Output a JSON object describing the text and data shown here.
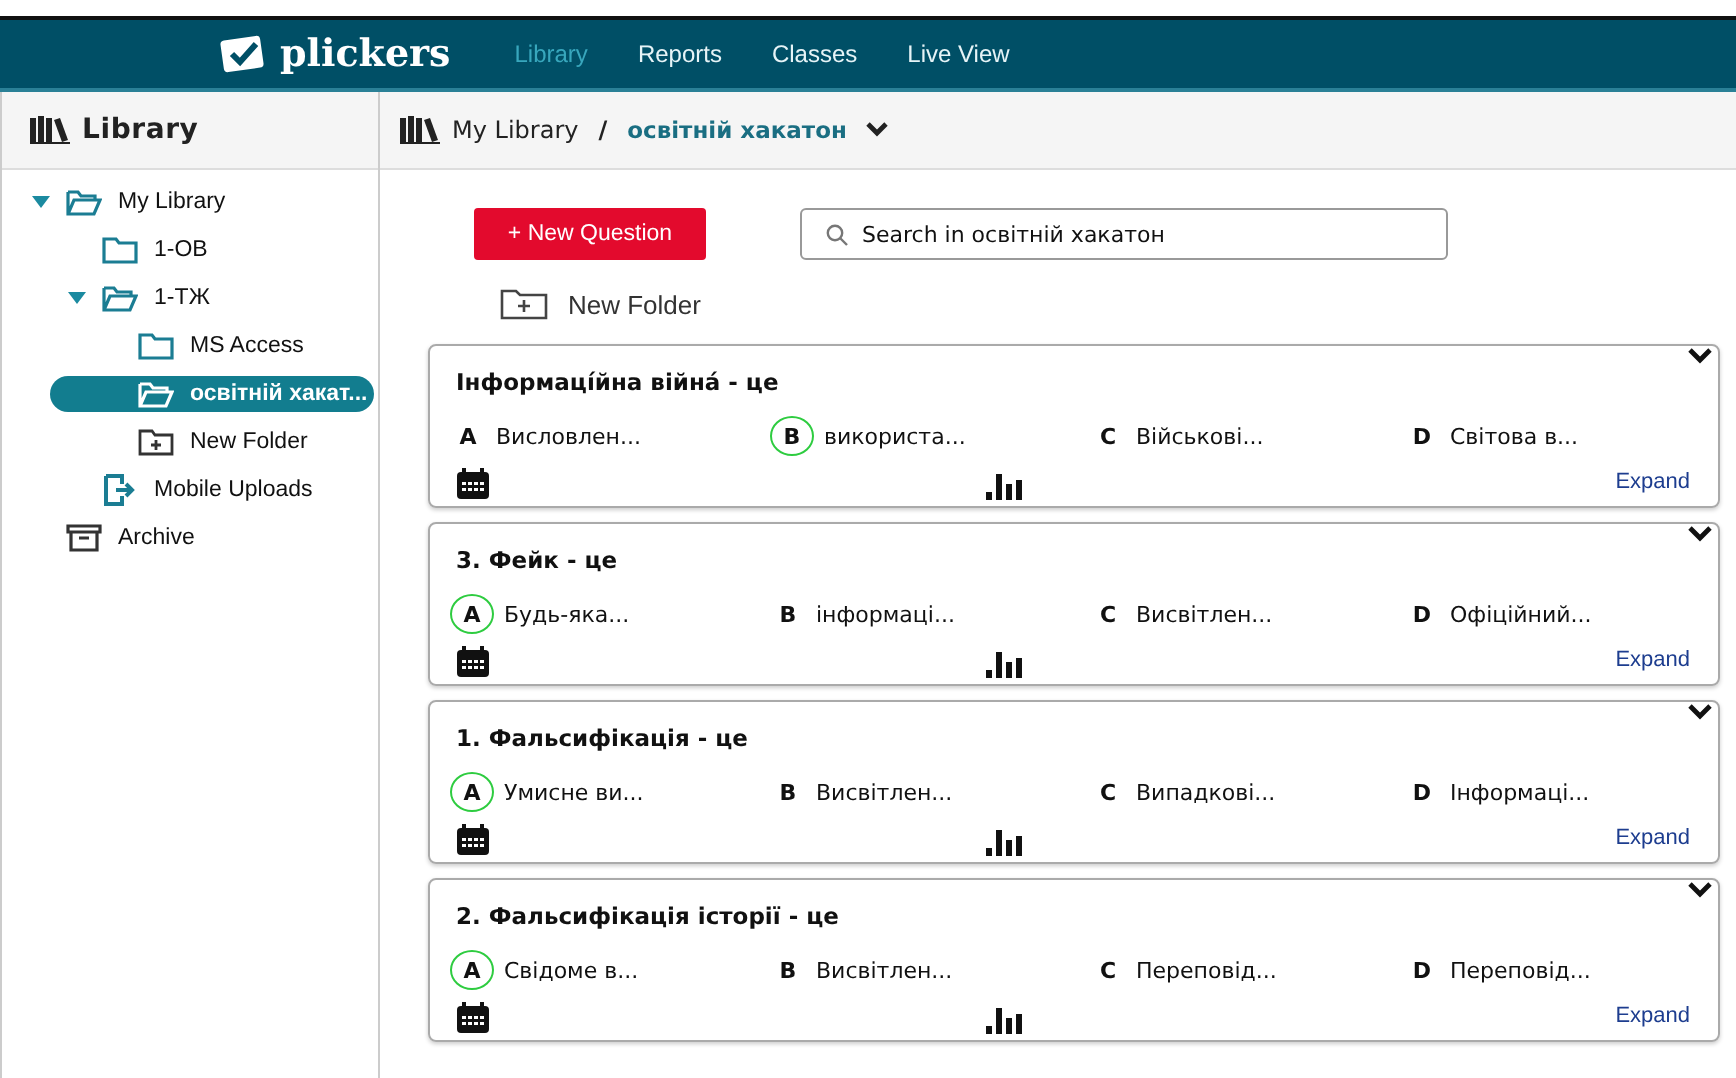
{
  "nav": {
    "logo": "plickers",
    "links": [
      {
        "label": "Library",
        "selected": true
      },
      {
        "label": "Reports",
        "selected": false
      },
      {
        "label": "Classes",
        "selected": false
      },
      {
        "label": "Live View",
        "selected": false
      }
    ]
  },
  "sidebar": {
    "title": "Library",
    "items": [
      {
        "label": "My Library",
        "kind": "folder",
        "expanded": true,
        "selected": false,
        "children": [
          {
            "label": "1-ОВ",
            "kind": "folder",
            "selected": false
          },
          {
            "label": "1-ТЖ",
            "kind": "folder",
            "expanded": true,
            "selected": false,
            "children": [
              {
                "label": "MS Access",
                "kind": "folder",
                "selected": false
              },
              {
                "label": "освітній хакат...",
                "kind": "folder",
                "selected": true
              },
              {
                "label": "New Folder",
                "kind": "new-folder",
                "selected": false
              }
            ]
          },
          {
            "label": "Mobile Uploads",
            "kind": "upload",
            "selected": false
          }
        ]
      },
      {
        "label": "Archive",
        "kind": "archive",
        "selected": false
      }
    ]
  },
  "breadcrumb": {
    "root": "My Library",
    "separator": "/",
    "current": "освітній хакатон"
  },
  "toolbar": {
    "new_question": "+ New Question",
    "search": {
      "placeholder": "Search in освітній хакатон"
    },
    "new_folder": "New Folder"
  },
  "questions": [
    {
      "title": "Інформаці́йна війна́ - це",
      "expand": "Expand",
      "choices": [
        {
          "letter": "A",
          "text": "Висловлен...",
          "correct": false
        },
        {
          "letter": "B",
          "text": "використа...",
          "correct": true
        },
        {
          "letter": "C",
          "text": "Військові...",
          "correct": false
        },
        {
          "letter": "D",
          "text": "Світова в...",
          "correct": false
        }
      ]
    },
    {
      "title": "3. Фейк - це",
      "expand": "Expand",
      "choices": [
        {
          "letter": "A",
          "text": "Будь-яка...",
          "correct": true
        },
        {
          "letter": "B",
          "text": "інформаці...",
          "correct": false
        },
        {
          "letter": "C",
          "text": "Висвітлен...",
          "correct": false
        },
        {
          "letter": "D",
          "text": "Офіційний...",
          "correct": false
        }
      ]
    },
    {
      "title": "1. Фальсифікація - це",
      "expand": "Expand",
      "choices": [
        {
          "letter": "A",
          "text": "Умисне ви...",
          "correct": true
        },
        {
          "letter": "B",
          "text": "Висвітлен...",
          "correct": false
        },
        {
          "letter": "C",
          "text": "Випадкові...",
          "correct": false
        },
        {
          "letter": "D",
          "text": "Інформаці...",
          "correct": false
        }
      ]
    },
    {
      "title": "2. Фальсифікація історії - це",
      "expand": "Expand",
      "choices": [
        {
          "letter": "A",
          "text": "Свідоме в...",
          "correct": true
        },
        {
          "letter": "B",
          "text": "Висвітлен...",
          "correct": false
        },
        {
          "letter": "C",
          "text": "Переповід...",
          "correct": false
        },
        {
          "letter": "D",
          "text": "Переповід...",
          "correct": false
        }
      ]
    }
  ]
}
